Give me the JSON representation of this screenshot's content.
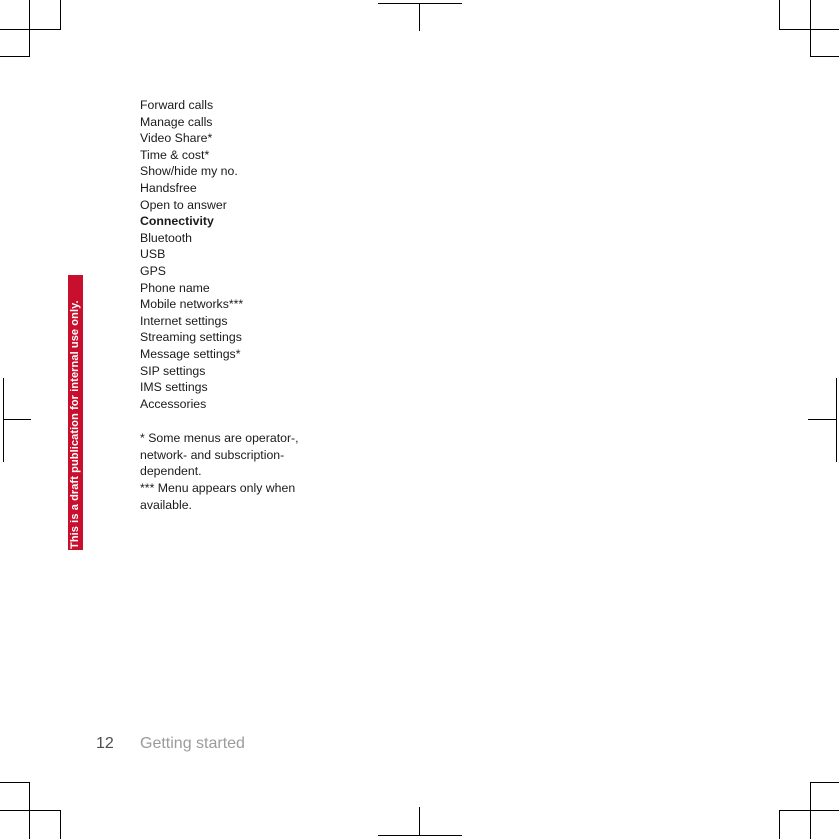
{
  "document": {
    "page_number": "12",
    "running_head": "Getting started",
    "draft_stamp": "This is a draft publication for internal use only.",
    "stamp_color": "#c8102e",
    "text_color": "#1a1a1a",
    "folio_color": "#4d4d4d",
    "running_head_color": "#9b9b9b"
  },
  "menu": {
    "items": [
      {
        "label": "Forward calls",
        "bold": false
      },
      {
        "label": "Manage calls",
        "bold": false
      },
      {
        "label": "Video Share*",
        "bold": false
      },
      {
        "label": "Time & cost*",
        "bold": false
      },
      {
        "label": "Show/hide my no.",
        "bold": false
      },
      {
        "label": "Handsfree",
        "bold": false
      },
      {
        "label": "Open to answer",
        "bold": false
      },
      {
        "label": "Connectivity",
        "bold": true
      },
      {
        "label": "Bluetooth",
        "bold": false
      },
      {
        "label": "USB",
        "bold": false
      },
      {
        "label": "GPS",
        "bold": false
      },
      {
        "label": "Phone name",
        "bold": false
      },
      {
        "label": "Mobile networks***",
        "bold": false
      },
      {
        "label": "Internet settings",
        "bold": false
      },
      {
        "label": "Streaming settings",
        "bold": false
      },
      {
        "label": "Message settings*",
        "bold": false
      },
      {
        "label": "SIP settings",
        "bold": false
      },
      {
        "label": "IMS settings",
        "bold": false
      },
      {
        "label": "Accessories",
        "bold": false
      }
    ]
  },
  "footnotes": {
    "lines": [
      "* Some menus are operator-, network- and subscription-dependent.",
      "*** Menu appears only when available."
    ]
  },
  "crop_marks": {
    "top_left": "crop-mark-top-left",
    "top_center": "crop-mark-top-center",
    "top_right": "crop-mark-top-right",
    "middle_left": "crop-mark-middle-left",
    "middle_right": "crop-mark-middle-right",
    "bottom_left": "crop-mark-bottom-left",
    "bottom_center": "crop-mark-bottom-center",
    "bottom_right": "crop-mark-bottom-right"
  }
}
